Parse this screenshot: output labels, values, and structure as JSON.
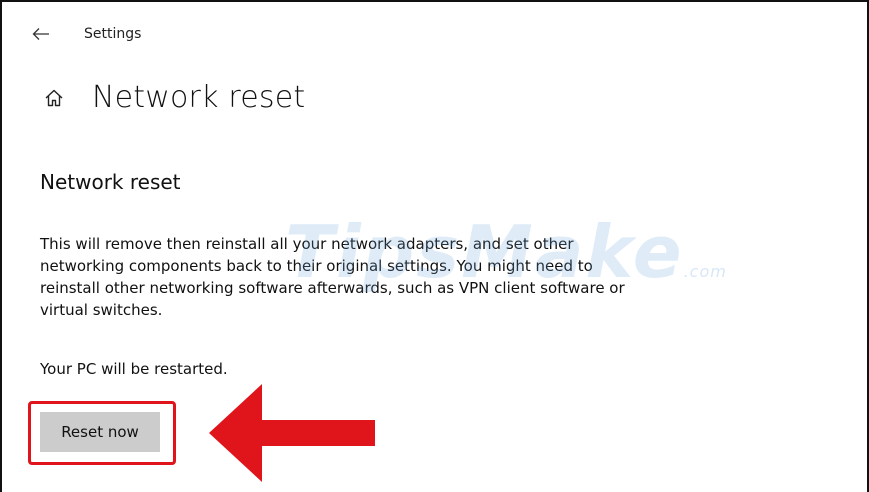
{
  "titlebar": {
    "back_icon": "back-arrow-icon",
    "title": "Settings"
  },
  "header": {
    "home_icon": "home-icon",
    "title": "Network reset"
  },
  "section": {
    "title": "Network reset",
    "description": "This will remove then reinstall all your network adapters, and set other networking components back to their original settings. You might need to reinstall other networking software afterwards, such as VPN client software or virtual switches.",
    "restart_note": "Your PC will be restarted."
  },
  "actions": {
    "reset_label": "Reset now"
  },
  "annotation": {
    "highlight_color": "#e0141b",
    "arrow_color": "#e0141b"
  },
  "watermark": {
    "text": "TipsMake",
    "suffix": ".com"
  }
}
